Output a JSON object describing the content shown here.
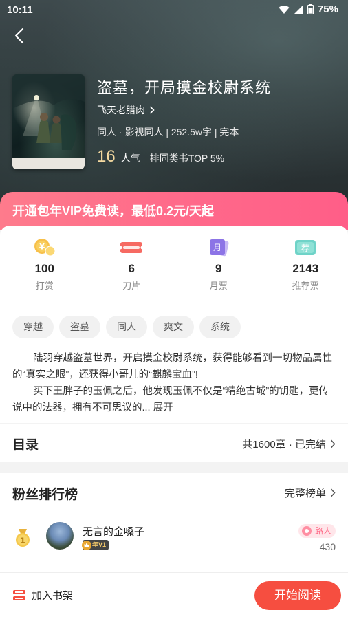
{
  "status_bar": {
    "time": "10:11",
    "battery": "75%"
  },
  "book": {
    "title": "盗墓，开局摸金校尉系统",
    "author": "飞天老腊肉",
    "meta": "同人 · 影视同人 | 252.5w字 | 完本",
    "popularity": "16",
    "popularity_label": "人气",
    "rank": "排同类书TOP 5%"
  },
  "vip_banner": "开通包年VIP免费读，最低0.2元/天起",
  "rewards": [
    {
      "value": "100",
      "label": "打赏",
      "icon": "coin-icon"
    },
    {
      "value": "6",
      "label": "刀片",
      "icon": "blade-icon"
    },
    {
      "value": "9",
      "label": "月票",
      "icon": "monthly-ticket-icon"
    },
    {
      "value": "2143",
      "label": "推荐票",
      "icon": "recommend-ticket-icon"
    }
  ],
  "reward_icon_text": {
    "monthly": "月",
    "recommend": "荐"
  },
  "tags": [
    "穿越",
    "盗墓",
    "同人",
    "爽文",
    "系统"
  ],
  "intro": {
    "p1": "陆羽穿越盗墓世界，开启摸金校尉系统，获得能够看到一切物品属性的“真实之眼”，还获得小哥儿的“麒麟宝血”!",
    "p2": "买下王胖子的玉佩之后，他发现玉佩不仅是“精绝古城”的钥匙，更传说中的法器，拥有不可思议的...",
    "expand": "展开"
  },
  "toc": {
    "title": "目录",
    "info": "共1600章 · 已完结"
  },
  "fans": {
    "title": "粉丝排行榜",
    "link": "完整榜单",
    "entries": [
      {
        "rank": "1",
        "name": "无言的金嗓子",
        "badge": "年V1",
        "role": "路人",
        "score": "430"
      }
    ]
  },
  "bottom": {
    "shelf": "加入书架",
    "read": "开始阅读"
  },
  "colors": {
    "accent": "#f64e40",
    "vip_gradient_start": "#fe7b8c",
    "vip_gradient_end": "#ff5e88",
    "popularity": "#f4d9a0"
  }
}
